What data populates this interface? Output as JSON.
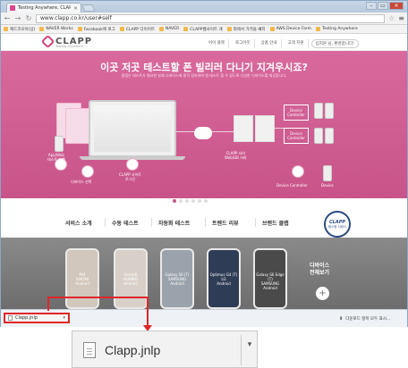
{
  "browser": {
    "tab_title": "Testing Anywhere, CLAPP",
    "tab_close": "×",
    "window_buttons": [
      "–",
      "▭",
      "✕"
    ],
    "url": "www.clapp.co.kr/user#self",
    "bookmarks": [
      "캐드코모아(상)",
      "NAVER Works",
      "Facebook에 로그",
      "CLAPP 다이어트",
      "NAVER",
      "CLAPP웹사이트 개",
      "외에서 가격을 쌔지",
      "AWS Device Farm",
      "Testing Anywhere"
    ]
  },
  "site": {
    "logo": "CLAPP",
    "logo_sub": "Testing Anywhere",
    "top_nav": [
      "아이 플랫",
      "로그아웃",
      "상품 안내",
      "고객 지원",
      "입지몬 님, 환영합니다!"
    ],
    "hero_title": "이곳 저곳 테스트할 폰 빌리러 다니기 지겨우시죠?",
    "hero_sub": "클랩은 테스트가 필요한 실제 디바이스에 원격 접속하여 앱 테스트 할 수 있도록 다양한 디바이스를 제공합니다.",
    "hero_labels": {
      "app_web": "App/Web\n테스트 수행",
      "device_select": "디바이스 선택",
      "clapp_agent": "CLAPP 사이트\n로그인",
      "clapp_server": "CLAPP 서버\nWeb/DB 서버",
      "device_ctrl_1": "Device\nController",
      "device_ctrl_2": "Device\nController",
      "device_ctrl_3": "Device Controller",
      "device": "Device"
    },
    "menu": [
      "서비스 소개",
      "수동 테스트",
      "자동화 테스트",
      "트렌드 리뷰",
      "브랜드 클랩"
    ],
    "badge_title": "CLAPP",
    "badge_sub": "테스팅 서비스",
    "phones": [
      {
        "name": "Mi4\nXIAOMI\nAndroid",
        "color": "#d2c7bc"
      },
      {
        "name": "Honor6\nHUAWEI\nAndroid",
        "color": "#d8d0c8"
      },
      {
        "name": "Galaxy S6 (T)\nSAMSUNG\nAndroid",
        "color": "#9aa3ab"
      },
      {
        "name": "Optimus G4 (T)\nLG\nAndroid",
        "color": "#2f3c55"
      },
      {
        "name": "Galaxy S6 Edge (T)\nSAMSUNG\nAndroid",
        "color": "#4a4a4a"
      }
    ],
    "all_devices": "디바이스\n전체보기",
    "plus": "+"
  },
  "download": {
    "file": "Clapp.jnlp",
    "show_all": "다운로드 항목 모두 표시...",
    "dropdown": "▾"
  }
}
